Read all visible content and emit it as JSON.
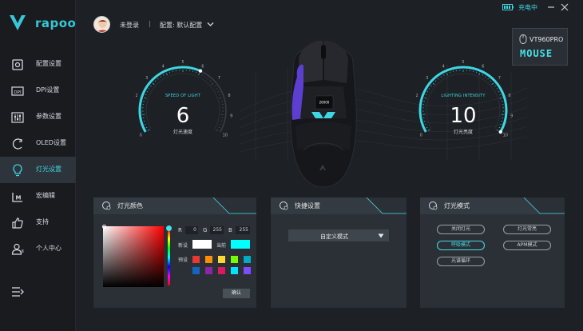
{
  "brand": {
    "logo_text": "rapoo"
  },
  "sidebar": {
    "items": [
      {
        "label": "配置设置",
        "icon": "config-icon"
      },
      {
        "label": "DPI设置",
        "icon": "dpi-icon"
      },
      {
        "label": "参数设置",
        "icon": "sliders-icon"
      },
      {
        "label": "OLED设置",
        "icon": "oled-icon"
      },
      {
        "label": "灯光设置",
        "icon": "lightbulb-icon",
        "active": true
      },
      {
        "label": "宏编辑",
        "icon": "macro-icon"
      },
      {
        "label": "支持",
        "icon": "thumbs-up-icon"
      },
      {
        "label": "个人中心",
        "icon": "user-icon"
      }
    ],
    "bottom_icon": "menu-icon"
  },
  "titlebar": {
    "status": "充电中",
    "battery_icon": "battery-icon"
  },
  "header": {
    "login": "未登录",
    "separator": "|",
    "config": "配置: 默认配置"
  },
  "device": {
    "model": "VT960PRO",
    "type": "MOUSE"
  },
  "gauges": {
    "speed": {
      "title": "SPEED OF LIGHT",
      "value": "6",
      "subtitle": "灯光速度",
      "max": 10,
      "ticks": [
        "0",
        "1",
        "2",
        "3",
        "4",
        "5",
        "6",
        "7",
        "8",
        "9",
        "10"
      ]
    },
    "intensity": {
      "title": "LIGHTING INTENSITY",
      "value": "10",
      "subtitle": "灯光亮度",
      "max": 10,
      "ticks": [
        "0",
        "1",
        "2",
        "3",
        "4",
        "5",
        "6",
        "7",
        "8",
        "9",
        "10"
      ]
    }
  },
  "mouse_screen": {
    "text": "26000"
  },
  "panels": {
    "color": {
      "title": "灯光颜色",
      "r_label": "R",
      "r": "0",
      "g_label": "G",
      "g": "255",
      "b_label": "B",
      "b": "255",
      "new_label": "新设",
      "current_label": "当前",
      "preset_label": "预设",
      "new_color": "#ffffff",
      "current_color": "#00ffff",
      "presets": [
        "#e53935",
        "#ff8f00",
        "#fdd835",
        "#76ff03",
        "#00acc1",
        "#1565c0",
        "#8e24aa",
        "#d81b60",
        "#00e5ff",
        "#7c4dff",
        "#ab47bc"
      ],
      "confirm": "确认"
    },
    "quick": {
      "title": "快捷设置",
      "mode": "自定义模式"
    },
    "mode": {
      "title": "灯光模式",
      "buttons": [
        {
          "label": "关闭灯光"
        },
        {
          "label": "灯光常亮"
        },
        {
          "label": "呼吸模式",
          "selected": true
        },
        {
          "label": "APM模式"
        },
        {
          "label": "光谱循环"
        }
      ]
    }
  },
  "colors": {
    "accent": "#3fd6e3",
    "background": "#1d2025",
    "panel": "#2b3036"
  }
}
